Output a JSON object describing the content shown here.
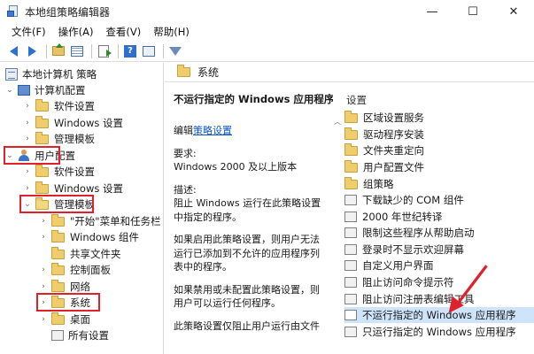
{
  "window": {
    "title": "本地组策略编辑器",
    "controls": [
      "—",
      "☐",
      "✕"
    ]
  },
  "menu": [
    "文件(F)",
    "操作(A)",
    "查看(V)",
    "帮助(H)"
  ],
  "tree": {
    "root": "本地计算机 策略",
    "computer_config": "计算机配置",
    "computer_children": [
      "软件设置",
      "Windows 设置",
      "管理模板"
    ],
    "user_config": "用户配置",
    "user_children": [
      "软件设置",
      "Windows 设置"
    ],
    "admin_templates": "管理模板",
    "admin_children": [
      "\"开始\"菜单和任务栏",
      "Windows 组件",
      "共享文件夹",
      "控制面板",
      "网络",
      "系统",
      "桌面",
      "所有设置"
    ]
  },
  "pane_header": "系统",
  "description": {
    "title": "不运行指定的 Windows 应用程序",
    "edit_prefix": "编辑",
    "edit_link": "策略设置",
    "requirement_label": "要求:",
    "requirement": "Windows 2000 及以上版本",
    "desc_label": "描述:",
    "desc": "阻止 Windows 运行在此策略设置中指定的程序。",
    "enabled": "如果启用此策略设置，则用户无法运行已添加到不允许的应用程序列表中的程序。",
    "disabled": "如果禁用或未配置此策略设置，则用户可以运行任何程序。",
    "more": "此策略设置仅阻止用户运行由文件"
  },
  "list": {
    "header": "设置",
    "items": [
      {
        "icon": "folder",
        "label": "区域设置服务"
      },
      {
        "icon": "folder",
        "label": "驱动程序安装"
      },
      {
        "icon": "folder",
        "label": "文件夹重定向"
      },
      {
        "icon": "folder",
        "label": "用户配置文件"
      },
      {
        "icon": "folder",
        "label": "组策略"
      },
      {
        "icon": "setting",
        "label": "下载缺少的 COM 组件"
      },
      {
        "icon": "setting",
        "label": "2000 年世纪转译"
      },
      {
        "icon": "setting",
        "label": "限制这些程序从帮助启动"
      },
      {
        "icon": "setting",
        "label": "登录时不显示欢迎屏幕"
      },
      {
        "icon": "setting",
        "label": "自定义用户界面"
      },
      {
        "icon": "setting",
        "label": "阻止访问命令提示符"
      },
      {
        "icon": "setting",
        "label": "阻止访问注册表编辑工具"
      },
      {
        "icon": "setting",
        "label": "不运行指定的 Windows 应用程序",
        "selected": true
      },
      {
        "icon": "setting",
        "label": "只运行指定的 Windows 应用程序"
      }
    ]
  },
  "colors": {
    "highlight_red": "#e0202a",
    "selection": "#cde4fb",
    "link": "#0b57c6"
  }
}
